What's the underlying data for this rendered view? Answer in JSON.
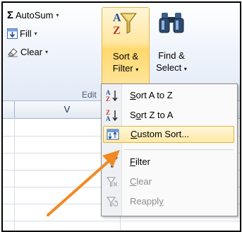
{
  "ribbon": {
    "autosum": {
      "symbol": "Σ",
      "label": "AutoSum",
      "caret": "▾"
    },
    "fill": {
      "label": "Fill",
      "caret": "▾"
    },
    "clear": {
      "label": "Clear",
      "caret": "▾"
    },
    "sort_filter": {
      "line1": "Sort &",
      "line2": "Filter",
      "caret": "▾"
    },
    "find_select": {
      "line1": "Find &",
      "line2": "Select",
      "caret": "▾"
    },
    "group_label": "Edit"
  },
  "sheet": {
    "column_header": "V"
  },
  "menu": {
    "items": [
      {
        "pre": "",
        "ul": "S",
        "post": "ort A to Z",
        "icon": "sort-a-to-z-icon",
        "enabled": true
      },
      {
        "pre": "S",
        "ul": "o",
        "post": "rt Z to A",
        "icon": "sort-z-to-a-icon",
        "enabled": true
      },
      {
        "pre": "",
        "ul": "C",
        "post": "ustom Sort...",
        "icon": "custom-sort-icon",
        "enabled": true,
        "highlighted": true
      },
      {
        "pre": "",
        "ul": "F",
        "post": "ilter",
        "icon": "filter-icon",
        "enabled": true
      },
      {
        "pre": "",
        "ul": "C",
        "post": "lear",
        "icon": "clear-filter-icon",
        "enabled": false
      },
      {
        "pre": "Reappl",
        "ul": "y",
        "post": "",
        "icon": "reapply-icon",
        "enabled": false
      }
    ]
  },
  "colors": {
    "highlight_border": "#e2b33e",
    "annotation_arrow": "#f08a24",
    "disabled_text": "#8d8d8d"
  }
}
